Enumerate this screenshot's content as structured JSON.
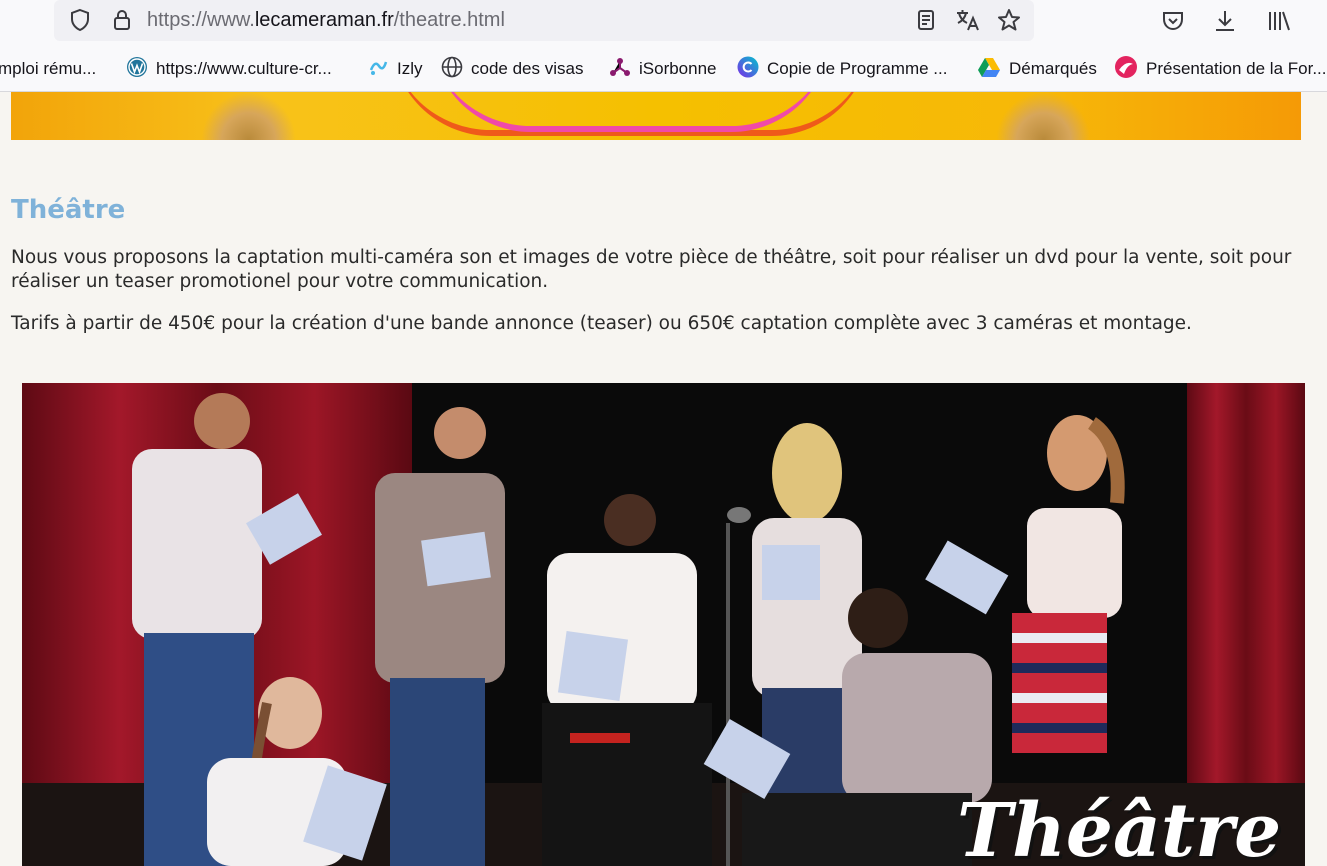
{
  "browser": {
    "url_prefix": "https://www.",
    "url_domain": "lecameraman.fr",
    "url_path": "/theatre.html",
    "icons": [
      "shield-icon",
      "lock-icon",
      "reader-view-icon",
      "translate-icon",
      "star-icon",
      "pocket-icon",
      "download-icon",
      "library-icon"
    ]
  },
  "bookmarks": [
    {
      "label": "mploi rému...",
      "icon": "none"
    },
    {
      "label": "https://www.culture-cr...",
      "icon": "wordpress-icon"
    },
    {
      "label": "Izly",
      "icon": "izly-icon"
    },
    {
      "label": "code des visas",
      "icon": "globe-icon"
    },
    {
      "label": "iSorbonne",
      "icon": "isorbonne-icon"
    },
    {
      "label": "Copie de Programme ...",
      "icon": "canva-icon"
    },
    {
      "label": "Démarqués",
      "icon": "google-drive-icon"
    },
    {
      "label": "Présentation de la For...",
      "icon": "pink-logo-icon"
    }
  ],
  "page": {
    "heading": "Théâtre",
    "paragraph1": "Nous vous proposons la captation multi-caméra son et images de votre pièce de théâtre, soit pour réaliser un dvd pour la vente, soit pour réaliser un teaser promotionel pour votre communication.",
    "paragraph2": "Tarifs à partir de 450€ pour la création d'une bande annonce (teaser) ou 650€ captation complète avec 3 caméras et montage.",
    "photo_title": "Théâtre"
  },
  "colors": {
    "heading": "#7fb2d9",
    "page_background": "#f7f5f1",
    "curtain": "#8e1220"
  }
}
